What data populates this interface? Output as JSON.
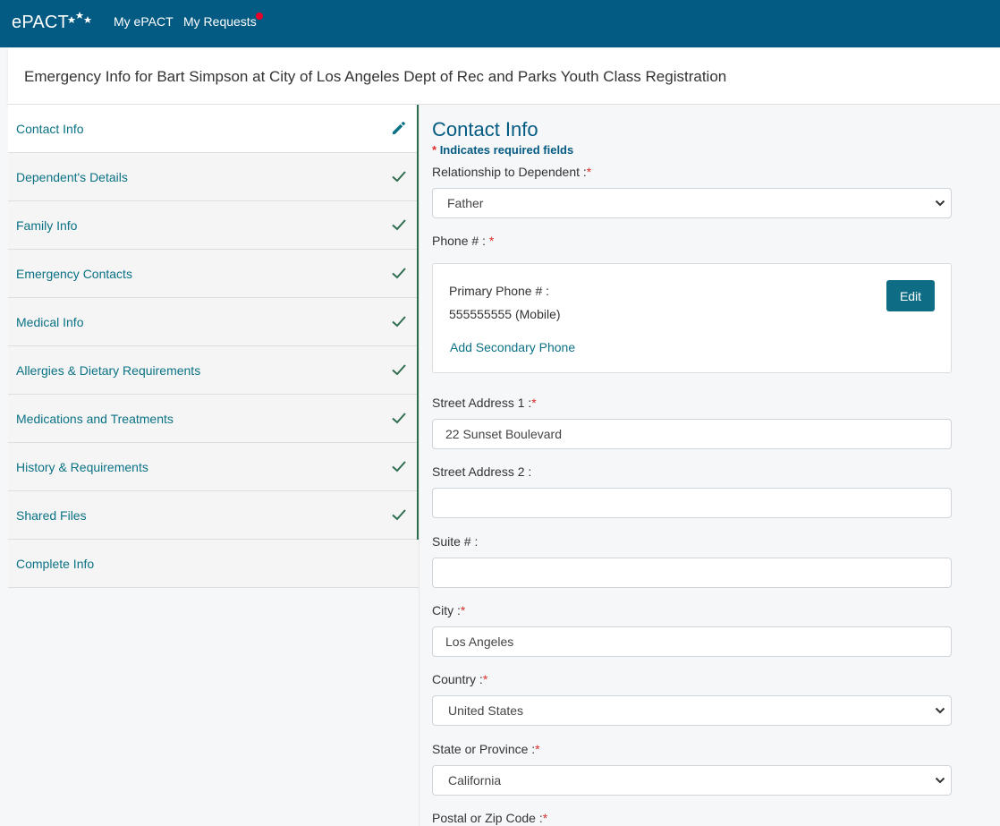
{
  "app": {
    "logo_text": "ePACT",
    "nav": {
      "my_epact": "My ePACT",
      "my_requests": "My Requests"
    }
  },
  "page": {
    "title": "Emergency Info for Bart Simpson at City of Los Angeles Dept of Rec and Parks Youth Class Registration"
  },
  "sidebar": {
    "items": [
      {
        "label": "Contact Info",
        "status": "editing",
        "icon": "pencil-icon"
      },
      {
        "label": "Dependent's Details",
        "status": "complete",
        "icon": "check-icon"
      },
      {
        "label": "Family Info",
        "status": "complete",
        "icon": "check-icon"
      },
      {
        "label": "Emergency Contacts",
        "status": "complete",
        "icon": "check-icon"
      },
      {
        "label": "Medical Info",
        "status": "complete",
        "icon": "check-icon"
      },
      {
        "label": "Allergies & Dietary Requirements",
        "status": "complete",
        "icon": "check-icon"
      },
      {
        "label": "Medications and Treatments",
        "status": "complete",
        "icon": "check-icon"
      },
      {
        "label": "History & Requirements",
        "status": "complete",
        "icon": "check-icon"
      },
      {
        "label": "Shared Files",
        "status": "complete",
        "icon": "check-icon"
      },
      {
        "label": "Complete Info",
        "status": "none",
        "icon": ""
      }
    ]
  },
  "form": {
    "title": "Contact Info",
    "required_star": "*",
    "required_note": "Indicates required fields",
    "relationship": {
      "label": "Relationship to Dependent :",
      "value": "Father"
    },
    "phone": {
      "label": "Phone # :",
      "primary_label": "Primary Phone # :",
      "primary_value": "555555555 (Mobile)",
      "edit_label": "Edit",
      "add_secondary": "Add Secondary Phone"
    },
    "street1": {
      "label": "Street Address 1 :",
      "value": "22 Sunset Boulevard"
    },
    "street2": {
      "label": "Street Address 2 :",
      "value": ""
    },
    "suite": {
      "label": "Suite # :",
      "value": ""
    },
    "city": {
      "label": "City :",
      "value": "Los Angeles"
    },
    "country": {
      "label": "Country :",
      "value": "United States"
    },
    "state": {
      "label": "State or Province :",
      "value": "California"
    },
    "postal": {
      "label": "Postal or Zip Code :"
    }
  },
  "colors": {
    "header": "#035a82",
    "accent": "#0b7285",
    "check": "#2e6d4f",
    "required": "#d9302c",
    "notification": "#e8002a"
  }
}
